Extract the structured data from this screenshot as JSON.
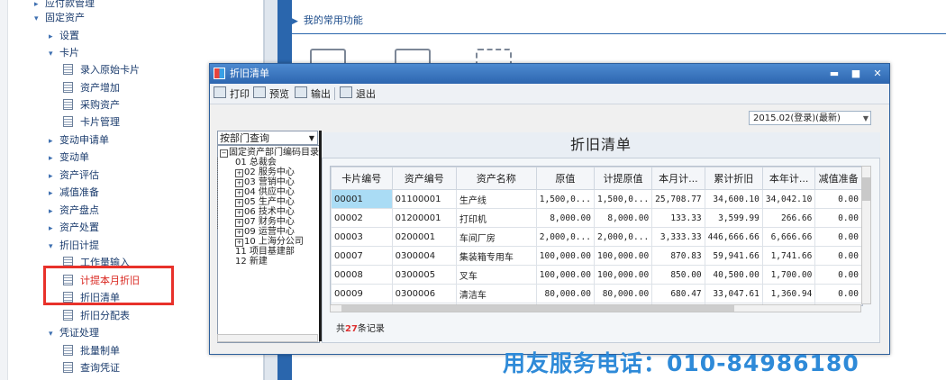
{
  "nav": {
    "items": [
      {
        "label": "应付款管理",
        "type": "group"
      },
      {
        "label": "固定资产",
        "type": "group-open"
      },
      {
        "label": "设置",
        "type": "folder"
      },
      {
        "label": "卡片",
        "type": "folder-open"
      },
      {
        "label": "录入原始卡片",
        "type": "leaf"
      },
      {
        "label": "资产增加",
        "type": "leaf"
      },
      {
        "label": "采购资产",
        "type": "leaf"
      },
      {
        "label": "卡片管理",
        "type": "leaf"
      },
      {
        "label": "变动申请单",
        "type": "folder"
      },
      {
        "label": "变动单",
        "type": "folder"
      },
      {
        "label": "资产评估",
        "type": "folder"
      },
      {
        "label": "减值准备",
        "type": "folder"
      },
      {
        "label": "资产盘点",
        "type": "folder"
      },
      {
        "label": "资产处置",
        "type": "folder"
      },
      {
        "label": "折旧计提",
        "type": "folder-open"
      },
      {
        "label": "工作量输入",
        "type": "leaf"
      },
      {
        "label": "计提本月折旧",
        "type": "leaf"
      },
      {
        "label": "折旧清单",
        "type": "leaf"
      },
      {
        "label": "折旧分配表",
        "type": "leaf"
      },
      {
        "label": "凭证处理",
        "type": "folder-open"
      },
      {
        "label": "批量制单",
        "type": "leaf"
      },
      {
        "label": "查询凭证",
        "type": "leaf"
      }
    ]
  },
  "favorites": {
    "title": "我的常用功能"
  },
  "dialog": {
    "title": "折旧清单",
    "toolbar": {
      "print": "打印",
      "preview": "预览",
      "export": "输出",
      "exit": "退出"
    },
    "period": "2015.02(登录)(最新)",
    "dept_select": "按部门查询",
    "tree": {
      "root": "固定资产部门编码目录",
      "nodes": [
        "01 总裁会",
        "02 服务中心",
        "03 营销中心",
        "04 供应中心",
        "05 生产中心",
        "06 技术中心",
        "07 财务中心",
        "09 运营中心",
        "10 上海分公司",
        "11 项目基建部",
        "12 新建"
      ]
    },
    "grid_title": "折旧清单",
    "columns": [
      "卡片编号",
      "资产编号",
      "资产名称",
      "原值",
      "计提原值",
      "本月计...",
      "累计折旧",
      "本年计...",
      "减值准备"
    ],
    "rows": [
      [
        "00001",
        "01100001",
        "生产线",
        "1,500,0...",
        "1,500,0...",
        "25,708.77",
        "34,600.10",
        "34,042.10",
        "0.00"
      ],
      [
        "00002",
        "01200001",
        "打印机",
        "8,000.00",
        "8,000.00",
        "133.33",
        "3,599.99",
        "266.66",
        "0.00"
      ],
      [
        "00003",
        "0200001",
        "车间厂房",
        "2,000,0...",
        "2,000,0...",
        "3,333.33",
        "446,666.66",
        "6,666.66",
        "0.00"
      ],
      [
        "00007",
        "0300004",
        "集装箱专用车",
        "100,000.00",
        "100,000.00",
        "870.83",
        "59,941.66",
        "1,741.66",
        "0.00"
      ],
      [
        "00008",
        "0300005",
        "叉车",
        "100,000.00",
        "100,000.00",
        "850.00",
        "40,500.00",
        "1,700.00",
        "0.00"
      ],
      [
        "00009",
        "0300006",
        "清洁车",
        "80,000.00",
        "80,000.00",
        "680.47",
        "33,047.61",
        "1,360.94",
        "0.00"
      ],
      [
        "",
        "",
        "",
        "",
        "",
        "",
        "",
        "",
        ""
      ]
    ],
    "record_prefix": "共",
    "record_count": "27",
    "record_suffix": "条记录"
  },
  "banner": {
    "phone": "用友服务电话：010-84986180"
  },
  "colors": {
    "highlight": "#e8312a",
    "accent": "#2a66ad",
    "phone": "#2e8ad8"
  }
}
